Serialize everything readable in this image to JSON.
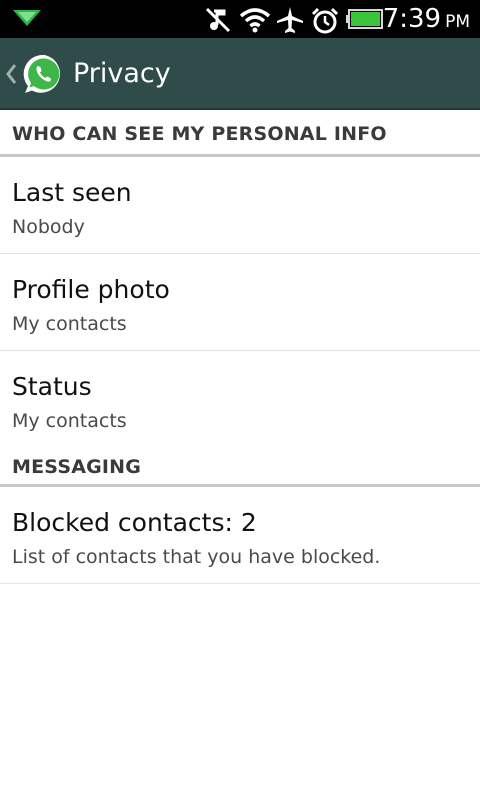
{
  "status_bar": {
    "time": "7:39",
    "ampm": "PM",
    "icons": [
      "notification-arrow-icon",
      "music-muted-icon",
      "wifi-icon",
      "airplane-icon",
      "alarm-icon",
      "battery-icon"
    ]
  },
  "action_bar": {
    "title": "Privacy",
    "back_icon": "chevron-left-icon",
    "logo_icon": "whatsapp-logo-icon"
  },
  "sections": [
    {
      "header": "WHO CAN SEE MY PERSONAL INFO",
      "items": [
        {
          "title": "Last seen",
          "summary": "Nobody"
        },
        {
          "title": "Profile photo",
          "summary": "My contacts"
        },
        {
          "title": "Status",
          "summary": "My contacts"
        }
      ]
    },
    {
      "header": "MESSAGING",
      "items": [
        {
          "title": "Blocked contacts: 2",
          "summary": "List of contacts that you have blocked."
        }
      ]
    }
  ],
  "colors": {
    "action_bar_bg": "#2f4b4a",
    "status_bar_bg": "#000000",
    "battery_fill": "#3dc43d",
    "whatsapp_green": "#3fb64a"
  }
}
